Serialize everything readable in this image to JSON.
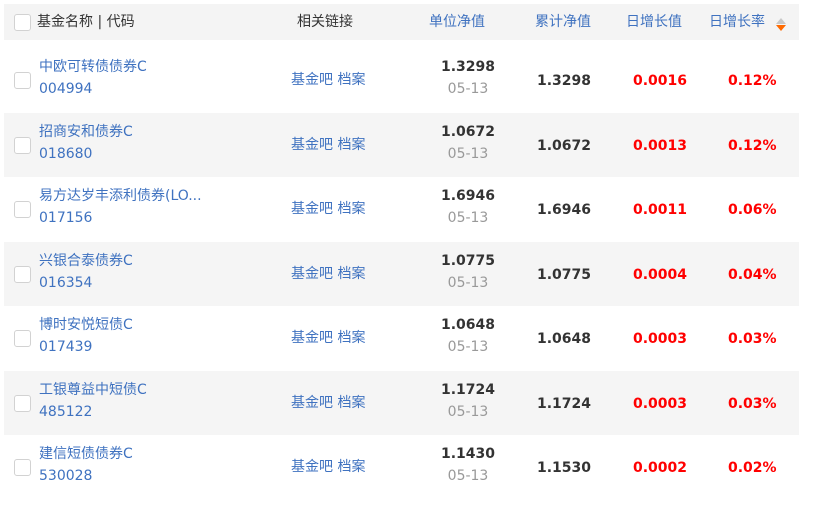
{
  "header": {
    "fund_name_code": "基金名称 | 代码",
    "related_links": "相关链接",
    "unit_nav": "单位净值",
    "cumulative_nav": "累计净值",
    "daily_growth_value": "日增长值",
    "daily_growth_rate": "日增长率"
  },
  "rows": [
    {
      "name": "中欧可转债债券C",
      "code": "004994",
      "link1": "基金吧",
      "link2": "档案",
      "nav": "1.3298",
      "date": "05-13",
      "cum_nav": "1.3298",
      "growth": "0.0016",
      "rate": "0.12%"
    },
    {
      "name": "招商安和债券C",
      "code": "018680",
      "link1": "基金吧",
      "link2": "档案",
      "nav": "1.0672",
      "date": "05-13",
      "cum_nav": "1.0672",
      "growth": "0.0013",
      "rate": "0.12%"
    },
    {
      "name": "易方达岁丰添利债券(LO...",
      "code": "017156",
      "link1": "基金吧",
      "link2": "档案",
      "nav": "1.6946",
      "date": "05-13",
      "cum_nav": "1.6946",
      "growth": "0.0011",
      "rate": "0.06%"
    },
    {
      "name": "兴银合泰债券C",
      "code": "016354",
      "link1": "基金吧",
      "link2": "档案",
      "nav": "1.0775",
      "date": "05-13",
      "cum_nav": "1.0775",
      "growth": "0.0004",
      "rate": "0.04%"
    },
    {
      "name": "博时安悦短债C",
      "code": "017439",
      "link1": "基金吧",
      "link2": "档案",
      "nav": "1.0648",
      "date": "05-13",
      "cum_nav": "1.0648",
      "growth": "0.0003",
      "rate": "0.03%"
    },
    {
      "name": "工银尊益中短债C",
      "code": "485122",
      "link1": "基金吧",
      "link2": "档案",
      "nav": "1.1724",
      "date": "05-13",
      "cum_nav": "1.1724",
      "growth": "0.0003",
      "rate": "0.03%"
    },
    {
      "name": "建信短债债券C",
      "code": "530028",
      "link1": "基金吧",
      "link2": "档案",
      "nav": "1.1430",
      "date": "05-13",
      "cum_nav": "1.1530",
      "growth": "0.0002",
      "rate": "0.02%"
    }
  ],
  "colors": {
    "link_blue": "#3f72c0",
    "positive_red": "#ff0000",
    "header_bg": "#f4f4f4",
    "row_alt_bg": "#f5f5f5",
    "sort_active": "#ff6a00"
  },
  "icons": {
    "sort": "sort-desc-icon"
  }
}
